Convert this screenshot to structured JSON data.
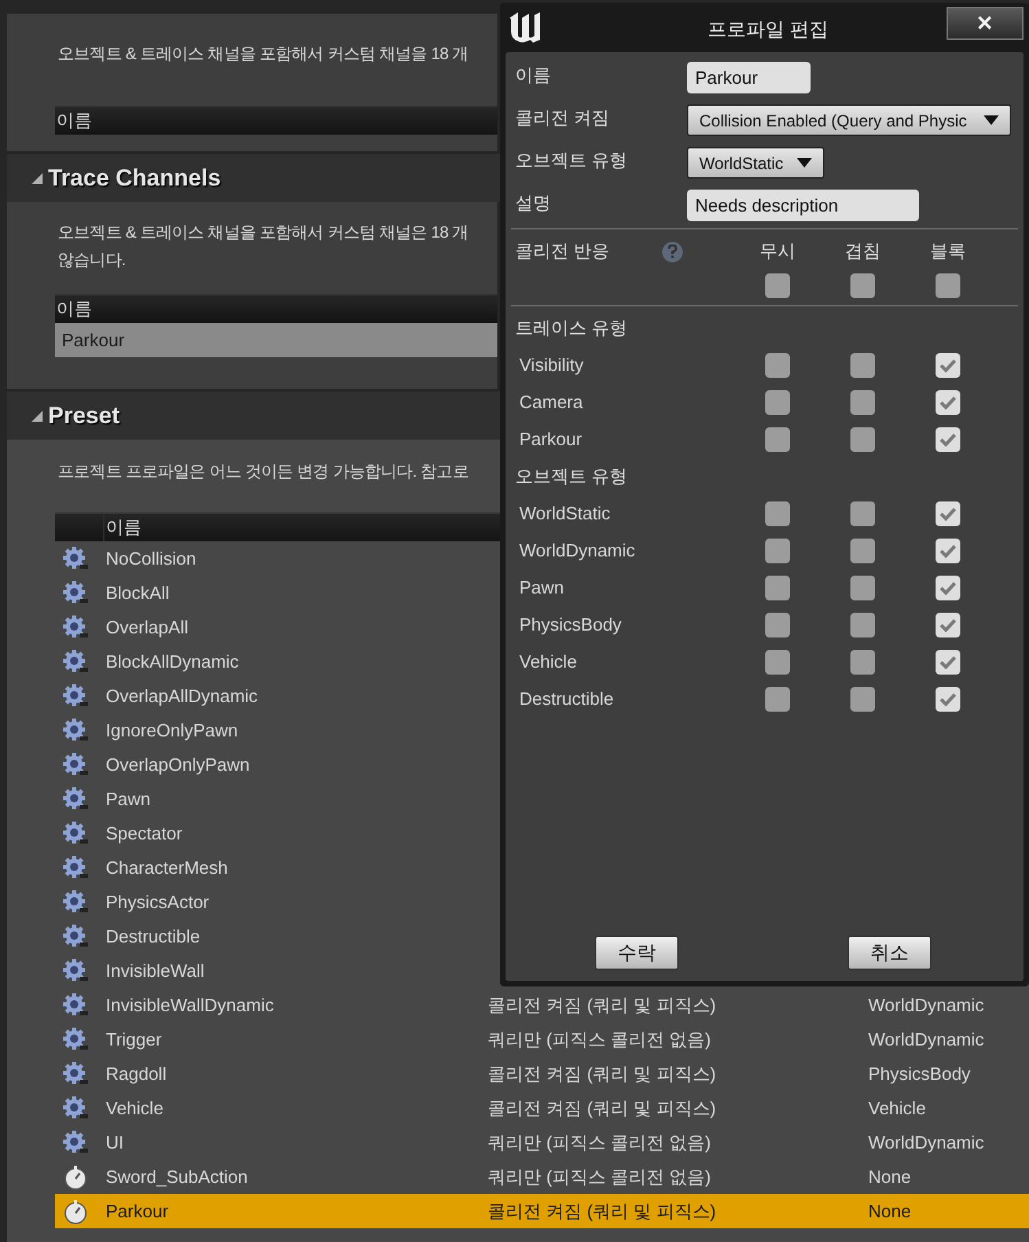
{
  "top_section": {
    "description": "오브젝트 & 트레이스 채널을 포함해서 커스텀 채널을 18 개",
    "table_header": "이름"
  },
  "trace_channels": {
    "title": "Trace Channels",
    "expanded": true,
    "description": [
      "오브젝트 & 트레이스 채널을 포함해서 커스텀 채널은 18 개",
      "않습니다."
    ],
    "table_header": "이름",
    "rows": [
      {
        "name": "Parkour",
        "selected": true
      }
    ]
  },
  "preset": {
    "title": "Preset",
    "expanded": true,
    "description": "프로젝트 프로파일은 어느 것이든 변경 가능합니다. 참고로",
    "table_header": "이름",
    "rows": [
      {
        "kind": "gear",
        "name": "NoCollision",
        "selected": false
      },
      {
        "kind": "gear",
        "name": "BlockAll",
        "selected": false
      },
      {
        "kind": "gear",
        "name": "OverlapAll",
        "selected": false
      },
      {
        "kind": "gear",
        "name": "BlockAllDynamic",
        "selected": false
      },
      {
        "kind": "gear",
        "name": "OverlapAllDynamic",
        "selected": false
      },
      {
        "kind": "gear",
        "name": "IgnoreOnlyPawn",
        "selected": false
      },
      {
        "kind": "gear",
        "name": "OverlapOnlyPawn",
        "selected": false
      },
      {
        "kind": "gear",
        "name": "Pawn",
        "selected": false
      },
      {
        "kind": "gear",
        "name": "Spectator",
        "selected": false
      },
      {
        "kind": "gear",
        "name": "CharacterMesh",
        "selected": false
      },
      {
        "kind": "gear",
        "name": "PhysicsActor",
        "selected": false
      },
      {
        "kind": "gear",
        "name": "Destructible",
        "selected": false
      },
      {
        "kind": "gear",
        "name": "InvisibleWall",
        "selected": false
      },
      {
        "kind": "gear",
        "name": "InvisibleWallDynamic",
        "column_2": "콜리전 켜짐 (쿼리 및 피직스)",
        "column_3": "WorldDynamic",
        "selected": false
      },
      {
        "kind": "gear",
        "name": "Trigger",
        "column_2": "쿼리만 (피직스 콜리전 없음)",
        "column_3": "WorldDynamic",
        "selected": false
      },
      {
        "kind": "gear",
        "name": "Ragdoll",
        "column_2": "콜리전 켜짐 (쿼리 및 피직스)",
        "column_3": "PhysicsBody",
        "selected": false
      },
      {
        "kind": "gear",
        "name": "Vehicle",
        "column_2": "콜리전 켜짐 (쿼리 및 피직스)",
        "column_3": "Vehicle",
        "selected": false
      },
      {
        "kind": "gear",
        "name": "UI",
        "column_2": "쿼리만 (피직스 콜리전 없음)",
        "column_3": "WorldDynamic",
        "selected": false
      },
      {
        "kind": "custom",
        "name": "Sword_SubAction",
        "column_2": "쿼리만 (피직스 콜리전 없음)",
        "column_3": "None",
        "selected": false
      },
      {
        "kind": "custom",
        "name": "Parkour",
        "column_2": "콜리전 켜짐 (쿼리 및 피직스)",
        "column_3": "None",
        "selected": true
      }
    ]
  },
  "dialog": {
    "title": "프로파일 편집",
    "close": "✕",
    "fields": [
      {
        "kind": "text",
        "label": "이름",
        "value": "Parkour"
      },
      {
        "kind": "dropdown",
        "label": "콜리전 켜짐",
        "value": "Collision Enabled (Query and Physic"
      },
      {
        "kind": "dropdown",
        "label": "오브젝트 유형",
        "value": "WorldStatic"
      },
      {
        "kind": "text",
        "label": "설명",
        "value": "Needs description"
      }
    ],
    "response": {
      "label": "콜리전 반응",
      "columns": [
        "무시",
        "겹침",
        "블록"
      ],
      "all": {
        "ignore": false,
        "overlap": false,
        "block": false
      }
    },
    "groups": [
      {
        "title": "트레이스 유형",
        "channels": [
          {
            "name": "Visibility",
            "ignore": false,
            "overlap": false,
            "block": true
          },
          {
            "name": "Camera",
            "ignore": false,
            "overlap": false,
            "block": true
          },
          {
            "name": "Parkour",
            "ignore": false,
            "overlap": false,
            "block": true
          }
        ]
      },
      {
        "title": "오브젝트 유형",
        "channels": [
          {
            "name": "WorldStatic",
            "ignore": false,
            "overlap": false,
            "block": true
          },
          {
            "name": "WorldDynamic",
            "ignore": false,
            "overlap": false,
            "block": true
          },
          {
            "name": "Pawn",
            "ignore": false,
            "overlap": false,
            "block": true
          },
          {
            "name": "PhysicsBody",
            "ignore": false,
            "overlap": false,
            "block": true
          },
          {
            "name": "Vehicle",
            "ignore": false,
            "overlap": false,
            "block": true
          },
          {
            "name": "Destructible",
            "ignore": false,
            "overlap": false,
            "block": true
          }
        ]
      }
    ],
    "buttons": [
      "수락",
      "취소"
    ]
  }
}
